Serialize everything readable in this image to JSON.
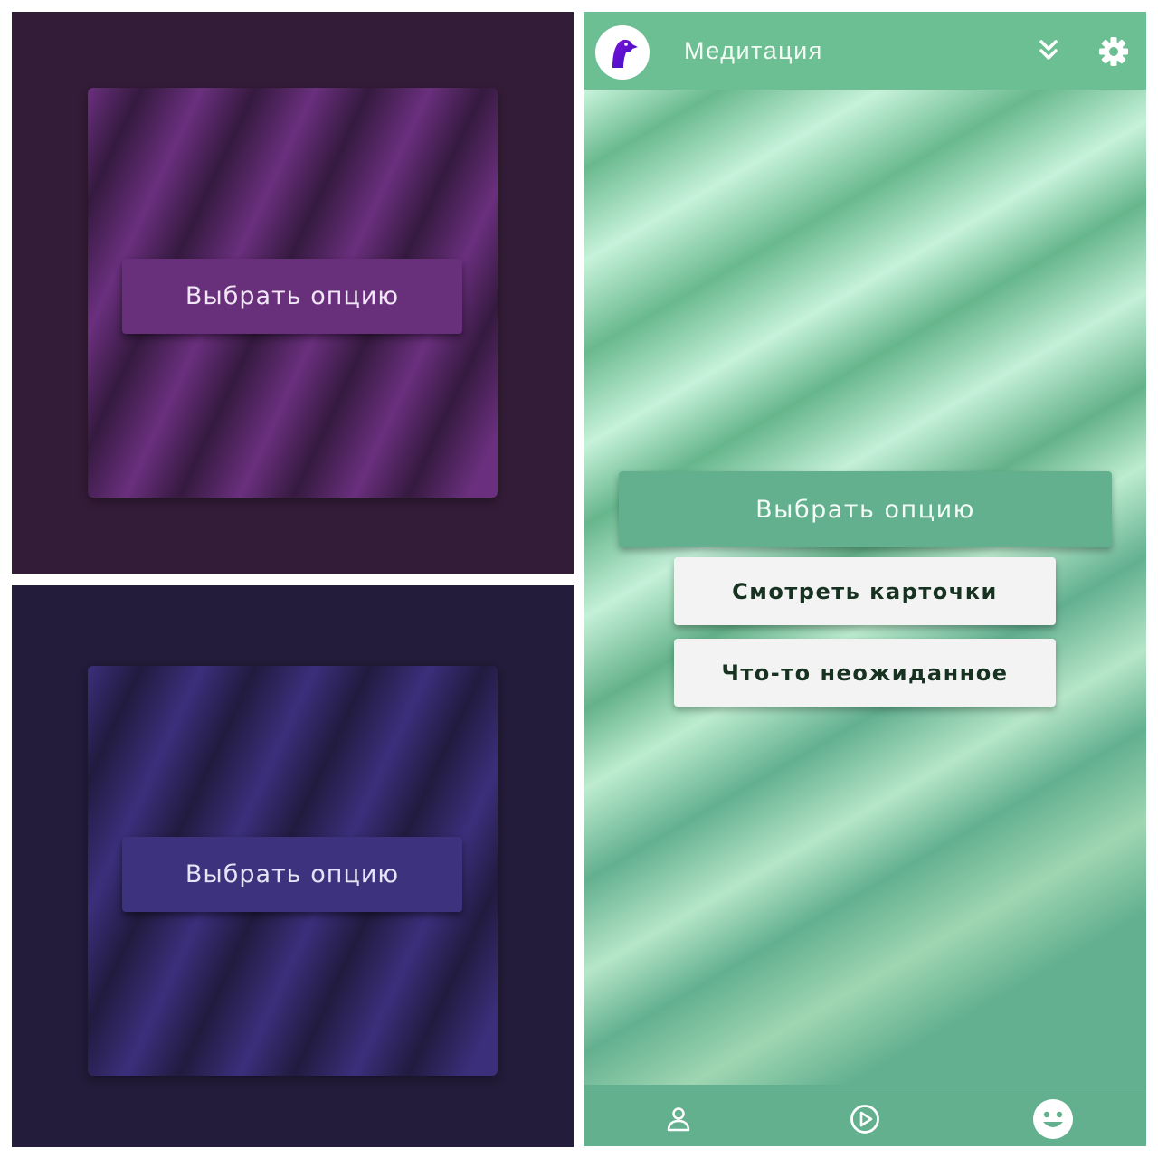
{
  "purple_screen": {
    "button_label": "Выбрать опцию"
  },
  "indigo_screen": {
    "button_label": "Выбрать опцию"
  },
  "phone_screen": {
    "header": {
      "title": "Медитация",
      "avatar_icon": "bird-logo-icon",
      "collapse_icon": "double-chevron-down-icon",
      "settings_icon": "gear-icon"
    },
    "buttons": {
      "choose_option": "Выбрать опцию",
      "view_cards": "Смотреть карточки",
      "something_unexpected": "Что-то неожиданное"
    },
    "bottom_nav": [
      {
        "icon": "person-icon",
        "active": false
      },
      {
        "icon": "play-circle-icon",
        "active": false
      },
      {
        "icon": "smiley-icon",
        "active": true
      }
    ]
  },
  "colors": {
    "purple_bg": "#331c37",
    "purple_accent": "#682f7a",
    "indigo_bg": "#231c3a",
    "indigo_accent": "#3d327d",
    "green_accent": "#62b08e",
    "green_header": "#6cbf92",
    "white_button": "#f3f3f3"
  }
}
